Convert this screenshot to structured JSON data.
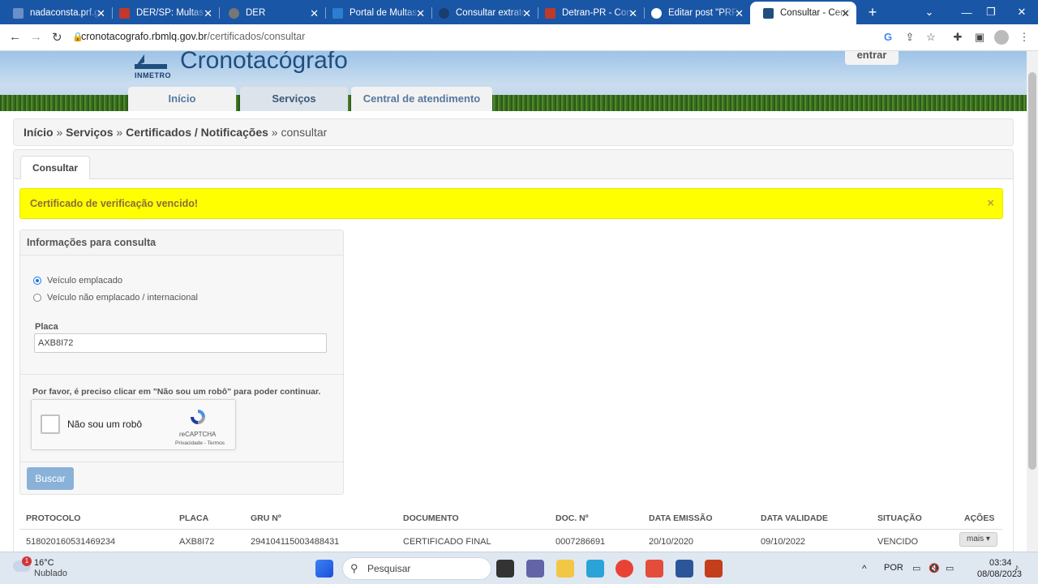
{
  "browser": {
    "tabs": [
      {
        "title": "nadaconsta.prf.gov.br",
        "favicon_color": "#6b8fc7"
      },
      {
        "title": "DER/SP: Multas e Infrações",
        "favicon_color": "#c0392b"
      },
      {
        "title": "DER",
        "favicon_color": "#777777"
      },
      {
        "title": "Portal de Multas - DER",
        "favicon_color": "#2d7dd2"
      },
      {
        "title": "Consultar extrato de débitos",
        "favicon_color": "#1b3d6e"
      },
      {
        "title": "Detran-PR - Consulta",
        "favicon_color": "#c0392b"
      },
      {
        "title": "Editar post \"PRF - Consulta\"",
        "favicon_color": "#ffffff"
      },
      {
        "title": "Consultar - Certificados",
        "favicon_color": "#1f4f7f",
        "active": true
      }
    ],
    "new_tab": "+",
    "url_domain": "cronotacografo.rbmlq.gov.br",
    "url_path": "/certificados/consultar"
  },
  "site": {
    "logo_text": "INMETRO",
    "title": "Cronotacógrafo",
    "login": "entrar",
    "menu": [
      "Início",
      "Serviços",
      "Central de atendimento"
    ]
  },
  "breadcrumb": {
    "home": "Início",
    "sep1": " » ",
    "services": "Serviços",
    "sep2": " » ",
    "certs": "Certificados / Notificações",
    "sep3": " » ",
    "current": "consultar"
  },
  "page_tab": "Consultar",
  "alert": {
    "text": "Certificado de verificação vencido!",
    "close": "×"
  },
  "form": {
    "heading": "Informações para consulta",
    "radio1": "Veículo emplacado",
    "radio2": "Veículo não emplacado / internacional",
    "plate_label": "Placa",
    "plate_value": "AXB8I72",
    "robot_msg": "Por favor, é preciso clicar em \"Não sou um robô\" para poder continuar.",
    "captcha_label": "Não sou um robô",
    "captcha_brand": "reCAPTCHA",
    "captcha_terms": "Privacidade - Termos",
    "search_button": "Buscar"
  },
  "table": {
    "headers": [
      "PROTOCOLO",
      "PLACA",
      "GRU Nº",
      "DOCUMENTO",
      "DOC. Nº",
      "DATA EMISSÃO",
      "DATA VALIDADE",
      "SITUAÇÃO",
      "AÇÕES"
    ],
    "rows": [
      [
        "518020160531469234",
        "AXB8I72",
        "294104115003488431",
        "CERTIFICADO FINAL",
        "0007286691",
        "20/10/2020",
        "09/10/2022",
        "VENCIDO"
      ]
    ],
    "action_button": "mais ▾"
  },
  "taskbar": {
    "weather_temp": "16°C",
    "weather_desc": "Nublado",
    "weather_badge": "1",
    "search_placeholder": "Pesquisar",
    "lang": "POR",
    "time": "03:34",
    "date": "08/08/2023"
  }
}
